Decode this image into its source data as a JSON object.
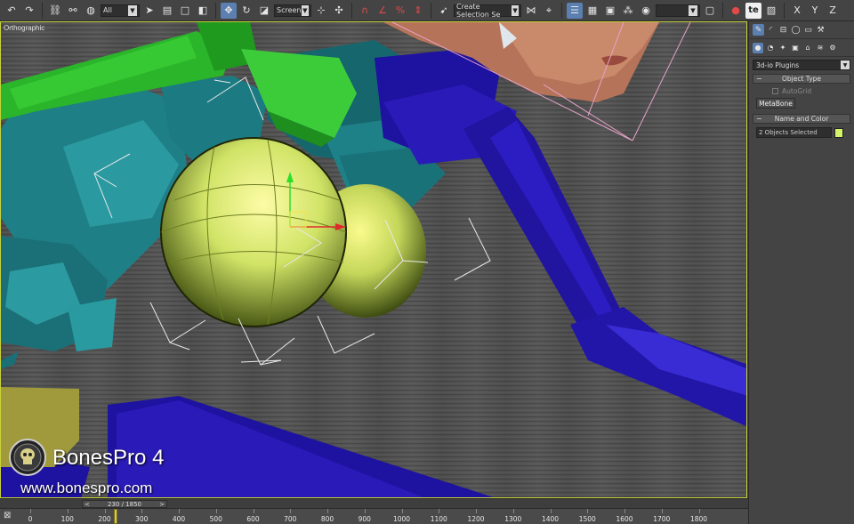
{
  "toolbar": {
    "filter_select": "All",
    "coord_select": "Screen",
    "selection_set": "Create Selection Se",
    "te_label": "te",
    "axis_x": "X",
    "axis_y": "Y",
    "axis_z": "Z"
  },
  "viewport": {
    "label": "Orthographic",
    "accent_color": "#c8d23a"
  },
  "watermark": {
    "title": "BonesPro 4",
    "url": "www.bonespro.com"
  },
  "command_panel": {
    "category_dropdown": "3d-io Plugins",
    "object_type": {
      "header": "Object Type",
      "autogrid_label": "AutoGrid",
      "autogrid_checked": false,
      "button_label": "MetaBone"
    },
    "name_and_color": {
      "header": "Name and Color",
      "name_value": "2 Objects Selected",
      "color": "#d4f46a"
    }
  },
  "timeline": {
    "frame_display": "230 / 1850",
    "current_frame": 230,
    "frame_count": 1850,
    "ruler_labels": [
      "0",
      "100",
      "200",
      "300",
      "400",
      "500",
      "600",
      "700",
      "800",
      "900",
      "1000",
      "1100",
      "1200",
      "1300",
      "1400",
      "1500",
      "1600",
      "1700",
      "1800"
    ]
  }
}
